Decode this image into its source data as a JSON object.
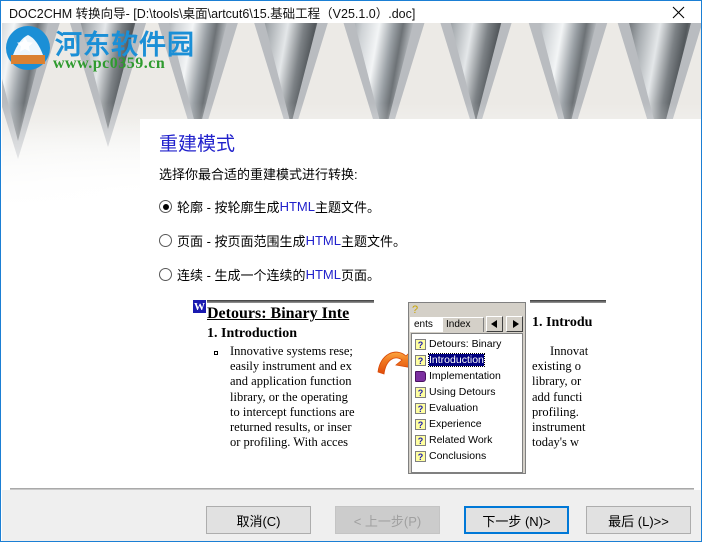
{
  "window": {
    "title": "DOC2CHM 转换向导- [D:\\tools\\桌面\\artcut6\\15.基础工程（V25.1.0）.doc]",
    "close_label": "close-icon",
    "border_color": "#1b7fd4"
  },
  "watermark": {
    "site_name": "河东软件园",
    "url": "www.pc0359.cn",
    "name_color": "#1b8fd6",
    "url_color": "#2f9b2f"
  },
  "content": {
    "heading": "重建模式",
    "heading_color": "#2222cc",
    "subtitle": "选择你最合适的重建模式进行转换:",
    "options": [
      {
        "label_before": "轮廓 - 按轮廓生成 ",
        "label_html": "HTML",
        "label_after": " 主题文件。",
        "checked": true
      },
      {
        "label_before": "页面 - 按页面范围生成 ",
        "label_html": "HTML",
        "label_after": " 主题文件。",
        "checked": false
      },
      {
        "label_before": "连续 - 生成一个连续的 ",
        "label_html": "HTML",
        "label_after": " 页面。",
        "checked": false
      }
    ]
  },
  "preview": {
    "word_icon": "W",
    "doc_title": "Detours: Binary Inte",
    "doc_heading": "1. Introduction",
    "doc_lines": [
      "Innovative systems rese;",
      "easily instrument and ex",
      "and application function",
      "library, or the operating",
      "to intercept functions are",
      "returned results, or inser",
      "or profiling.  With acces"
    ],
    "chm": {
      "tab_contents": "ents",
      "tab_index": "Index",
      "prev_arrow": "◀",
      "next_arrow": "▶",
      "tree_items": [
        {
          "label": "Detours: Binary",
          "type": "page",
          "selected": false
        },
        {
          "label": "Introduction",
          "type": "page",
          "selected": true
        },
        {
          "label": "Implementation",
          "type": "book",
          "selected": false
        },
        {
          "label": "Using Detours",
          "type": "page",
          "selected": false
        },
        {
          "label": "Evaluation",
          "type": "page",
          "selected": false
        },
        {
          "label": "Experience",
          "type": "page",
          "selected": false
        },
        {
          "label": "Related Work",
          "type": "page",
          "selected": false
        },
        {
          "label": "Conclusions",
          "type": "page",
          "selected": false
        }
      ]
    },
    "html_heading": "1. Introdu",
    "html_lines": [
      "Innovat",
      "existing o",
      "library, or",
      "add functi",
      "profiling.",
      "instrument",
      "today's  w"
    ]
  },
  "footer": {
    "buttons": [
      {
        "name": "cancel",
        "label": "取消(C)",
        "state": "normal"
      },
      {
        "name": "previous",
        "label": "< 上一步(P)",
        "state": "disabled"
      },
      {
        "name": "next",
        "label": "下一步 (N)>",
        "state": "default"
      },
      {
        "name": "last",
        "label": "最后 (L)>>",
        "state": "normal"
      }
    ],
    "accent_color": "#0078d7"
  }
}
